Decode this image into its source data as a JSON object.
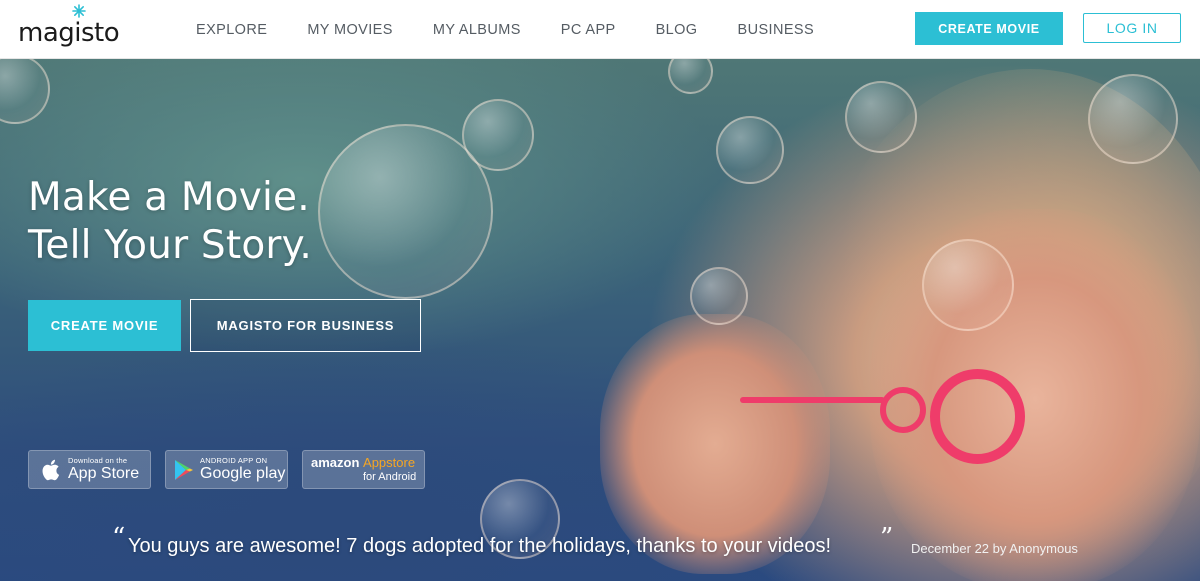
{
  "header": {
    "logo": "magisto",
    "nav": [
      "EXPLORE",
      "MY MOVIES",
      "MY ALBUMS",
      "PC APP",
      "BLOG",
      "BUSINESS"
    ],
    "create_movie": "CREATE MOVIE",
    "login": "LOG IN"
  },
  "hero": {
    "headline_line1": "Make a Movie.",
    "headline_line2": "Tell Your Story.",
    "create_movie": "CREATE MOVIE",
    "business": "MAGISTO FOR BUSINESS"
  },
  "stores": {
    "apple_small": "Download on the",
    "apple_big": "App Store",
    "google_small": "ANDROID APP ON",
    "google_big": "Google play",
    "amazon_brand": "amazon",
    "amazon_appstore": "Appstore",
    "amazon_sub": "for Android"
  },
  "testimonial": {
    "open_mark": "“",
    "text": "You guys are awesome! 7 dogs adopted for the holidays, thanks to your videos!",
    "close_mark": "”",
    "meta": "December 22 by Anonymous"
  },
  "colors": {
    "accent": "#2cbfd4",
    "nav_text": "#555c63"
  }
}
